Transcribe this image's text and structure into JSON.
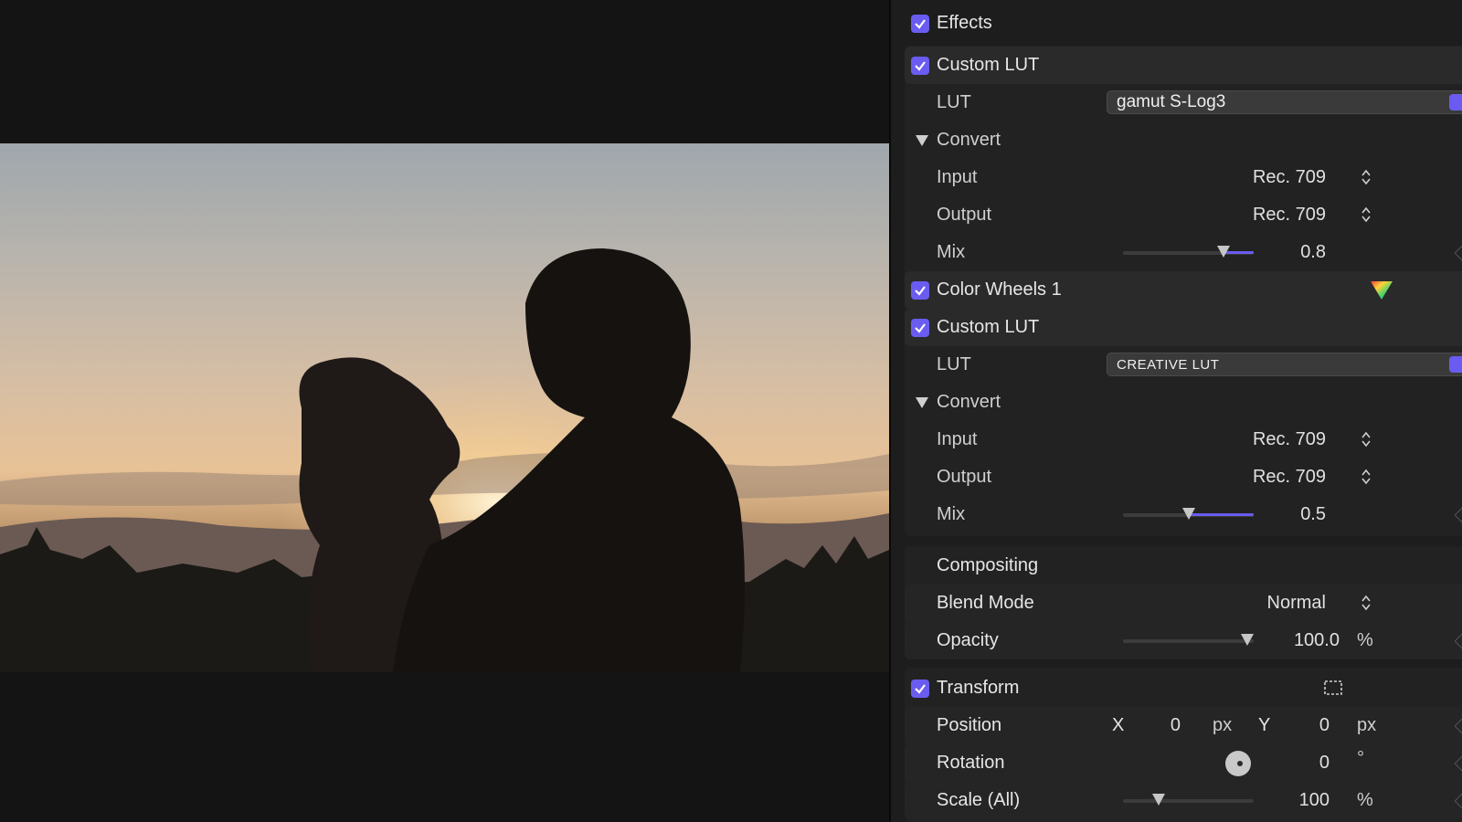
{
  "inspector": {
    "effects": {
      "label": "Effects"
    },
    "lut1": {
      "title": "Custom LUT",
      "lut_label": "LUT",
      "lut_value": "gamut S-Log3",
      "convert_label": "Convert",
      "input_label": "Input",
      "input_value": "Rec. 709",
      "output_label": "Output",
      "output_value": "Rec. 709",
      "mix_label": "Mix",
      "mix_value": "0.8",
      "mix_level": 0.8
    },
    "color_wheels": {
      "title": "Color Wheels 1"
    },
    "lut2": {
      "title": "Custom LUT",
      "lut_label": "LUT",
      "lut_value": "CREATIVE LUT",
      "convert_label": "Convert",
      "input_label": "Input",
      "input_value": "Rec. 709",
      "output_label": "Output",
      "output_value": "Rec. 709",
      "mix_label": "Mix",
      "mix_value": "0.5",
      "mix_level": 0.5
    },
    "compositing": {
      "title": "Compositing",
      "blend_label": "Blend Mode",
      "blend_value": "Normal",
      "opacity_label": "Opacity",
      "opacity_value": "100.0",
      "opacity_unit": "%",
      "opacity_level": 1.0
    },
    "transform": {
      "title": "Transform",
      "position_label": "Position",
      "x_label": "X",
      "x_value": "0",
      "x_unit": "px",
      "y_label": "Y",
      "y_value": "0",
      "y_unit": "px",
      "rotation_label": "Rotation",
      "rotation_value": "0",
      "rotation_unit": "°",
      "scale_label": "Scale (All)",
      "scale_value": "100",
      "scale_unit": "%"
    }
  },
  "colors": {
    "accent": "#6a5cf0",
    "panel": "#1d1d1d",
    "header": "#2a2a2a"
  }
}
